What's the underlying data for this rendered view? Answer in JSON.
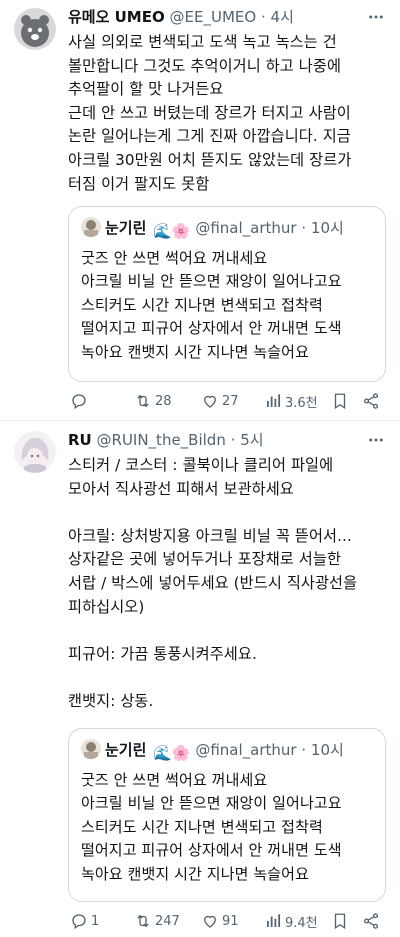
{
  "posts": [
    {
      "author_name": "유메오 UMEO",
      "handle": "@EE_UMEO",
      "dot": "·",
      "time": "4시",
      "text": "사실 의외로 변색되고 도색 녹고 녹스는 건\n볼만합니다 그것도 추억이거니 하고 나중에\n추억팔이 할 맛 나거든요\n근데 안 쓰고 버텼는데 장르가 터지고 사람이\n논란 일어나는게 그게 진짜 아깝습니다. 지금\n아크릴 30만원 어치 뜯지도 않았는데 장르가\n터짐 이거 팔지도 못함",
      "quote": {
        "name": "눈기린",
        "emojis": "🌊🌸",
        "handle": "@final_arthur",
        "dot": "·",
        "time": "10시",
        "text": "굿즈 안 쓰면 썩어요 꺼내세요\n아크릴 비닐 안 뜯으면 재앙이 일어나고요\n스티커도 시간 지나면 변색되고 접착력\n떨어지고 피규어 상자에서 안 꺼내면 도색\n녹아요 캔뱃지 시간 지나면 녹슬어요"
      },
      "actions": {
        "replies": "",
        "retweets": "28",
        "likes": "27",
        "views": "3.6천"
      }
    },
    {
      "author_name": "RU",
      "handle": "@RUIN_the_Bildn",
      "dot": "·",
      "time": "5시",
      "text": "스티커 / 코스터 : 콜북이나 클리어 파일에\n모아서 직사광선 피해서 보관하세요\n\n아크릴: 상처방지용 아크릴 비닐 꼭 뜯어서...\n상자같은 곳에 넣어두거나 포장채로 서늘한\n서랍 / 박스에 넣어두세요 (반드시 직사광선을\n피하십시오)\n\n피규어: 가끔 통풍시켜주세요.\n\n캔뱃지: 상동.",
      "quote": {
        "name": "눈기린",
        "emojis": "🌊🌸",
        "handle": "@final_arthur",
        "dot": "·",
        "time": "10시",
        "text": "굿즈 안 쓰면 썩어요 꺼내세요\n아크릴 비닐 안 뜯으면 재앙이 일어나고요\n스티커도 시간 지나면 변색되고 접착력\n떨어지고 피규어 상자에서 안 꺼내면 도색\n녹아요 캔뱃지 시간 지나면 녹슬어요"
      },
      "actions": {
        "replies": "1",
        "retweets": "247",
        "likes": "91",
        "views": "9.4천"
      }
    }
  ],
  "colors": {
    "text": "#0f1419",
    "secondary": "#536471",
    "border": "#cfd9de",
    "divider": "#eff3f4"
  },
  "icons": [
    "reply-icon",
    "retweet-icon",
    "like-icon",
    "views-icon",
    "bookmark-icon",
    "share-icon",
    "more-icon"
  ]
}
